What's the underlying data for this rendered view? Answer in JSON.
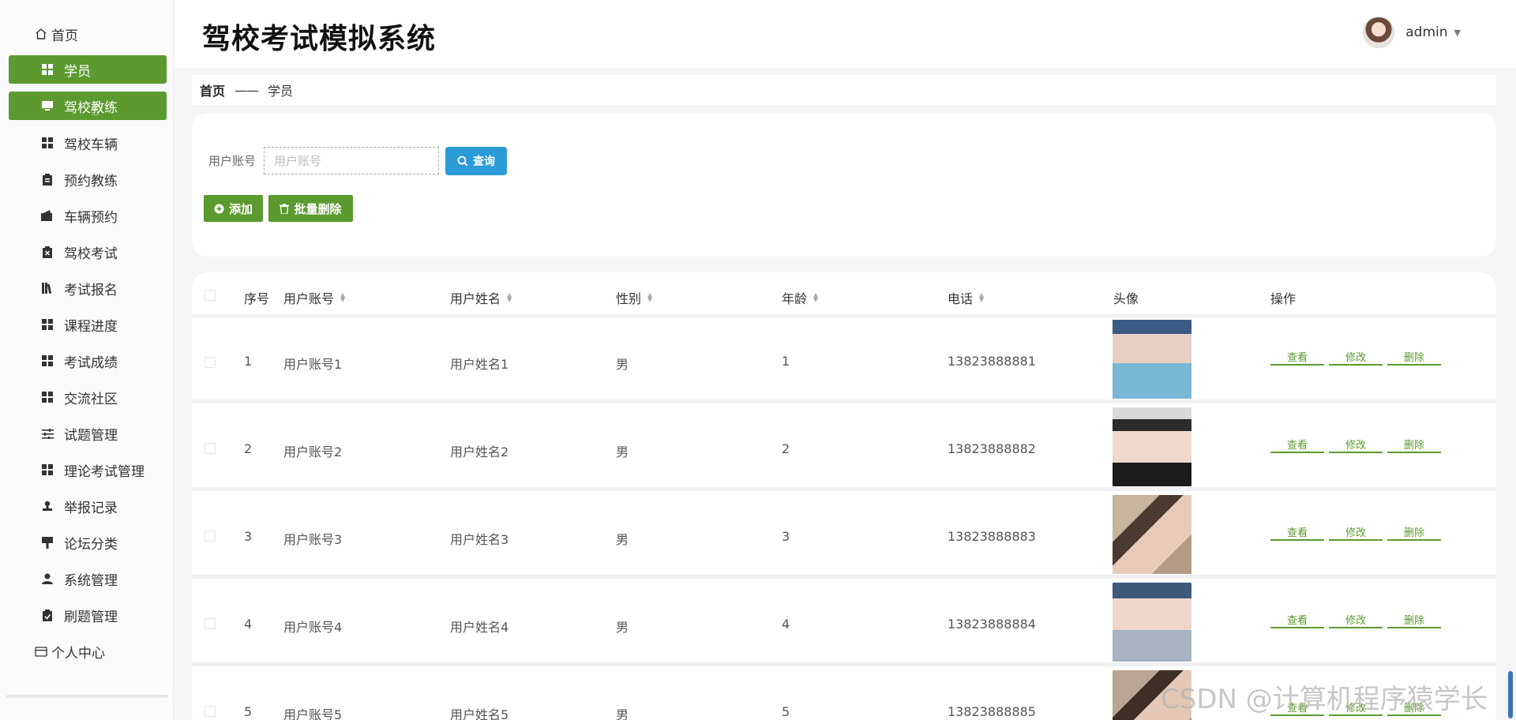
{
  "app": {
    "title": "驾校考试模拟系统",
    "user": "admin"
  },
  "sidebar": {
    "items": [
      {
        "label": "首页",
        "icon": "home-icon"
      },
      {
        "label": "学员",
        "icon": "grid-icon"
      },
      {
        "label": "驾校教练",
        "icon": "monitor-icon"
      },
      {
        "label": "驾校车辆",
        "icon": "grid-icon"
      },
      {
        "label": "预约教练",
        "icon": "clipboard-icon"
      },
      {
        "label": "车辆预约",
        "icon": "wallet-icon"
      },
      {
        "label": "驾校考试",
        "icon": "clipboard-x-icon"
      },
      {
        "label": "考试报名",
        "icon": "books-icon"
      },
      {
        "label": "课程进度",
        "icon": "grid-icon"
      },
      {
        "label": "考试成绩",
        "icon": "grid-icon"
      },
      {
        "label": "交流社区",
        "icon": "grid-icon"
      },
      {
        "label": "试题管理",
        "icon": "sliders-icon"
      },
      {
        "label": "理论考试管理",
        "icon": "grid-icon"
      },
      {
        "label": "举报记录",
        "icon": "stamp-icon"
      },
      {
        "label": "论坛分类",
        "icon": "sign-icon"
      },
      {
        "label": "系统管理",
        "icon": "user-icon"
      },
      {
        "label": "刷题管理",
        "icon": "clipboard-check-icon"
      },
      {
        "label": "个人中心",
        "icon": "card-icon"
      }
    ]
  },
  "breadcrumb": {
    "home": "首页",
    "separator": "——",
    "current": "学员"
  },
  "search": {
    "label": "用户账号",
    "placeholder": "用户账号",
    "value": "",
    "query_button": "查询",
    "add_button": "添加",
    "batch_delete_button": "批量删除"
  },
  "table": {
    "headers": {
      "index": "序号",
      "account": "用户账号",
      "name": "用户姓名",
      "gender": "性别",
      "age": "年龄",
      "phone": "电话",
      "avatar": "头像",
      "actions": "操作"
    },
    "rows": [
      {
        "index": "1",
        "account": "用户账号1",
        "name": "用户姓名1",
        "gender": "男",
        "age": "1",
        "phone": "13823888881"
      },
      {
        "index": "2",
        "account": "用户账号2",
        "name": "用户姓名2",
        "gender": "男",
        "age": "2",
        "phone": "13823888882"
      },
      {
        "index": "3",
        "account": "用户账号3",
        "name": "用户姓名3",
        "gender": "男",
        "age": "3",
        "phone": "13823888883"
      },
      {
        "index": "4",
        "account": "用户账号4",
        "name": "用户姓名4",
        "gender": "男",
        "age": "4",
        "phone": "13823888884"
      },
      {
        "index": "5",
        "account": "用户账号5",
        "name": "用户姓名5",
        "gender": "男",
        "age": "5",
        "phone": "13823888885"
      }
    ],
    "row_actions": {
      "view": "查看",
      "edit": "修改",
      "delete": "删除"
    }
  },
  "watermark": "CSDN @计算机程序猿学长",
  "colors": {
    "accent_green": "#5b9a2f",
    "query_blue": "#2a9bd6"
  }
}
